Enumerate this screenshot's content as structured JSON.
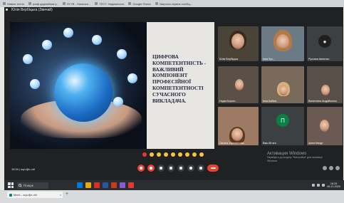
{
  "bookmarks": [
    {
      "label": "Новые титли"
    },
    {
      "label": "граф дедлайнов у..."
    },
    {
      "label": "ЕГУВ - Начальн..."
    },
    {
      "label": "ТЕСТ: Надежность"
    },
    {
      "label": "Google Поиск"
    },
    {
      "label": "Запросы сервис сообщ..."
    }
  ],
  "meeting": {
    "title": "Юлія Вербіцька (Звичай)",
    "time": "16:34 | sqn-fjtx-ohl"
  },
  "slide": {
    "title": "ЦИФРОВА КОМПЕТЕНТНІСТЬ - ВАЖЛИВИЙ КОМПОНЕНТ ПРОФЕСІЙНОЇ КОМПЕТЕНТНОСТІ СУЧАСНОГО ВИКЛАДАЧА."
  },
  "participants": [
    {
      "name": "Юлія Вербіцька"
    },
    {
      "name": "Інна Хуч..."
    },
    {
      "name": "Руслана Іваненко"
    },
    {
      "name": "Надія Беранг..."
    },
    {
      "name": "Інна Бабіна"
    },
    {
      "name": "Валентина Андрійченко"
    },
    {
      "name": "Оксана Хорошилова"
    },
    {
      "name": "Ваш 66 ага",
      "initial": "П"
    },
    {
      "name": "Ірина Мазур"
    }
  ],
  "windows_activation": {
    "title": "Активация Windows",
    "subtitle": "Перейдіть до розділу \"Настройки\" для активації Windows"
  },
  "taskbar": {
    "search_placeholder": "Пошук",
    "clock_time": "16:29",
    "clock_date": "06.11.2020"
  },
  "browser_tab": {
    "label": "Meet – sqn-fjtx-ohl"
  },
  "colors": {
    "stage_bg": "#1f2123",
    "hangup": "#ea4335",
    "taskbar_bg": "#2a2d31"
  }
}
